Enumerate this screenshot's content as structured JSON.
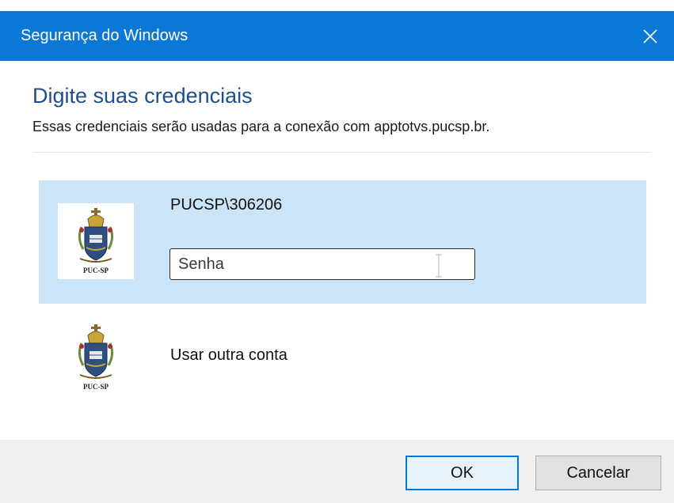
{
  "window": {
    "title": "Segurança do Windows",
    "close_icon": "close-icon"
  },
  "dialog": {
    "heading": "Digite suas credenciais",
    "description": "Essas credenciais serão usadas para a conexão com apptotvs.pucsp.br."
  },
  "accounts": [
    {
      "username": "PUCSP\\306206",
      "logo_icon": "pucsp-crest-icon",
      "logo_text": "PUC-SP",
      "password": {
        "value": "",
        "placeholder": "Senha"
      }
    },
    {
      "label": "Usar outra conta",
      "logo_icon": "pucsp-crest-icon",
      "logo_text": "PUC-SP"
    }
  ],
  "buttons": {
    "ok": "OK",
    "cancel": "Cancelar"
  },
  "colors": {
    "titlebar": "#0a78d4",
    "selected_row": "#cce4f7",
    "heading": "#1f4e8c",
    "ok_border": "#0078d7"
  }
}
